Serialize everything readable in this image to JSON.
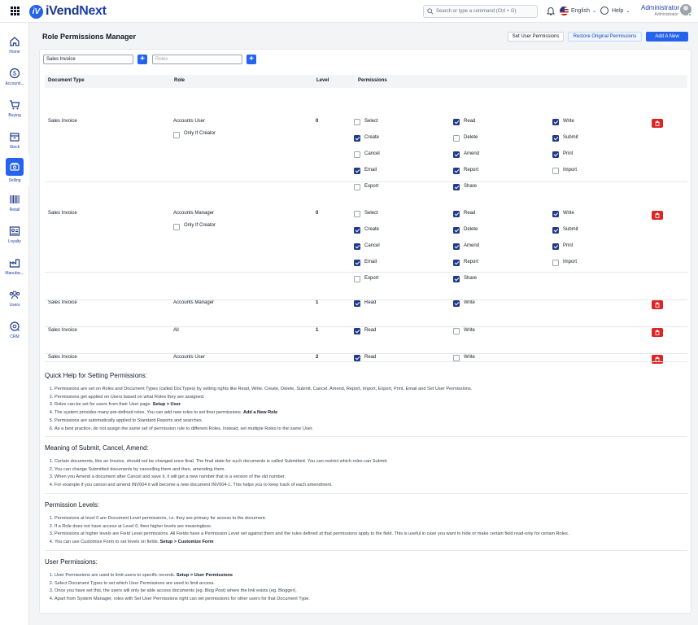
{
  "app": {
    "logo_mark": "iV",
    "brand_a": "iVend",
    "brand_b": "Next"
  },
  "topbar": {
    "search_placeholder": "Search or type a command (Ctrl + G)",
    "language": "English",
    "help": "Help",
    "user_name": "Administrator",
    "user_role": "Administrator"
  },
  "sidebar": [
    {
      "label": "Home",
      "icon": "home-icon"
    },
    {
      "label": "Accounti...",
      "icon": "dollar-icon"
    },
    {
      "label": "Buying",
      "icon": "cart-icon"
    },
    {
      "label": "Stock",
      "icon": "box-icon"
    },
    {
      "label": "Selling",
      "icon": "selling-icon",
      "active": true
    },
    {
      "label": "Retail",
      "icon": "barcode-icon"
    },
    {
      "label": "Loyalty",
      "icon": "loyalty-icon"
    },
    {
      "label": "Manufac...",
      "icon": "factory-icon"
    },
    {
      "label": "Users",
      "icon": "users-icon"
    },
    {
      "label": "CRM",
      "icon": "crm-icon"
    }
  ],
  "page": {
    "title": "Role Permissions Manager",
    "btn_set_user": "Set User Permissions",
    "btn_restore": "Restore Original Permissions",
    "btn_add_rule": "Add A New Rule",
    "doctype_filter": "Sales Invoice",
    "roles_placeholder": "Roles",
    "plus": "+"
  },
  "table": {
    "headers": [
      "Document Type",
      "Role",
      "Level",
      "Permissions"
    ],
    "only_if_creator": "Only If Creator",
    "rows": [
      {
        "doctype": "Sales Invoice",
        "role": "Accounts User",
        "level": "0",
        "creator": true,
        "perms": [
          [
            "Select",
            false
          ],
          [
            "Read",
            true
          ],
          [
            "Write",
            true
          ],
          [
            "Create",
            true
          ],
          [
            "Delete",
            false
          ],
          [
            "Submit",
            true
          ],
          [
            "Cancel",
            false
          ],
          [
            "Amend",
            true
          ],
          [
            "Print",
            true
          ],
          [
            "Email",
            true
          ],
          [
            "Report",
            true
          ],
          [
            "Import",
            false
          ],
          [
            "Export",
            false
          ],
          [
            "Share",
            true
          ]
        ]
      },
      {
        "doctype": "Sales Invoice",
        "role": "Accounts Manager",
        "level": "0",
        "creator": true,
        "perms": [
          [
            "Select",
            false
          ],
          [
            "Read",
            true
          ],
          [
            "Write",
            true
          ],
          [
            "Create",
            true
          ],
          [
            "Delete",
            true
          ],
          [
            "Submit",
            true
          ],
          [
            "Cancel",
            true
          ],
          [
            "Amend",
            true
          ],
          [
            "Print",
            true
          ],
          [
            "Email",
            true
          ],
          [
            "Report",
            true
          ],
          [
            "Import",
            false
          ],
          [
            "Export",
            false
          ],
          [
            "Share",
            true
          ]
        ]
      },
      {
        "doctype": "Sales Invoice",
        "role": "Accounts Manager",
        "level": "1",
        "creator": false,
        "perms": [
          [
            "Read",
            true
          ],
          [
            "Write",
            true
          ]
        ]
      },
      {
        "doctype": "Sales Invoice",
        "role": "All",
        "level": "1",
        "creator": false,
        "perms": [
          [
            "Read",
            true
          ],
          [
            "Write",
            false
          ]
        ]
      },
      {
        "doctype": "Sales Invoice",
        "role": "Accounts User",
        "level": "2",
        "creator": false,
        "perms": [
          [
            "Read",
            true
          ],
          [
            "Write",
            false
          ]
        ]
      }
    ]
  },
  "help": [
    {
      "title": "Quick Help for Setting Permissions:",
      "items": [
        [
          "Permissions are set on Roles and Document Types (called DocTypes) by setting rights like Read, Write, Create, Delete, Submit, Cancel, Amend, Report, Import, Export, Print, Email and Set User Permissions.",
          ""
        ],
        [
          "Permissions get applied on Users based on what Roles they are assigned.",
          ""
        ],
        [
          "Roles can be set for users from their User page. ",
          "Setup > User"
        ],
        [
          "The system provides many pre-defined roles. You can add new roles to set finer permissions. ",
          "Add a New Role"
        ],
        [
          "Permissions are automatically applied to Standard Reports and searches.",
          ""
        ],
        [
          "As a best practice, do not assign the same set of permission rule to different Roles. Instead, set multiple Roles to the same User.",
          ""
        ]
      ]
    },
    {
      "title": "Meaning of Submit, Cancel, Amend:",
      "items": [
        [
          "Certain documents, like an Invoice, should not be changed once final. The final state for such documents is called Submitted. You can restrict which roles can Submit.",
          ""
        ],
        [
          "You can change Submitted documents by cancelling them and then, amending them.",
          ""
        ],
        [
          "When you Amend a document after Cancel and save it, it will get a new number that is a version of the old number.",
          ""
        ],
        [
          "For example if you cancel and amend INV004 it will become a new document INV004-1. This helps you to keep track of each amendment.",
          ""
        ]
      ]
    },
    {
      "title": "Permission Levels:",
      "items": [
        [
          "Permissions at level 0 are Document Level permissions, i.e. they are primary for access to the document.",
          ""
        ],
        [
          "If a Role does not have access at Level 0, then higher levels are meaningless.",
          ""
        ],
        [
          "Permissions at higher levels are Field Level permissions. All Fields have a Permission Level set against them and the rules defined at that permissions apply to the field. This is useful in case you want to hide or make certain field read-only for certain Roles.",
          ""
        ],
        [
          "You can use Customize Form to set levels on fields. ",
          "Setup > Customize Form"
        ]
      ]
    },
    {
      "title": "User Permissions:",
      "items": [
        [
          "User Permissions are used to limit users to specific records. ",
          "Setup > User Permissions"
        ],
        [
          "Select Document Types to set which User Permissions are used to limit access.",
          ""
        ],
        [
          "Once you have set this, the users will only be able access documents (eg. Blog Post) where the link exists (eg. Blogger).",
          ""
        ],
        [
          "Apart from System Manager, roles with Set User Permissions right can set permissions for other users for that Document Type.",
          ""
        ]
      ]
    }
  ]
}
